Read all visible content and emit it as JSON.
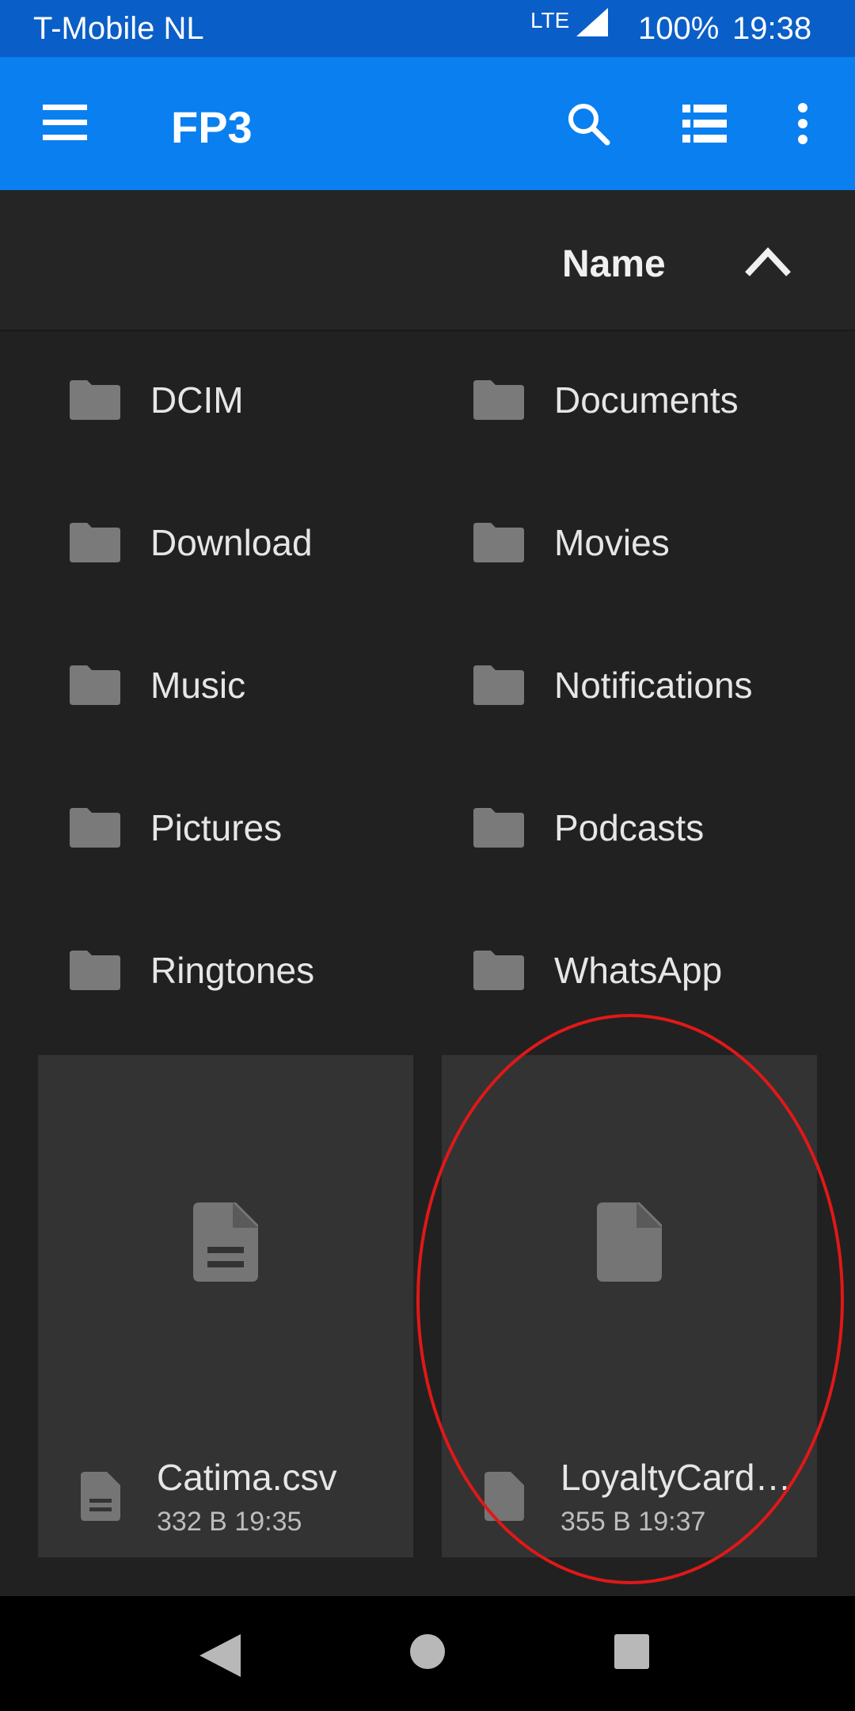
{
  "status_bar": {
    "carrier": "T-Mobile  NL",
    "network": "LTE",
    "battery": "100%",
    "time": "19:38"
  },
  "app_bar": {
    "title": "FP3",
    "icons": [
      "menu-icon",
      "search-icon",
      "list-view-icon",
      "more-vert-icon"
    ]
  },
  "sort": {
    "label": "Name",
    "direction_icon": "chevron-up-icon"
  },
  "folders": [
    {
      "name": "DCIM"
    },
    {
      "name": "Documents"
    },
    {
      "name": "Download"
    },
    {
      "name": "Movies"
    },
    {
      "name": "Music"
    },
    {
      "name": "Notifications"
    },
    {
      "name": "Pictures"
    },
    {
      "name": "Podcasts"
    },
    {
      "name": "Ringtones"
    },
    {
      "name": "WhatsApp"
    }
  ],
  "files": [
    {
      "name": "Catima.csv",
      "size": "332 B",
      "time": "19:35",
      "meta": "332 B 19:35",
      "icon": "text-document-icon"
    },
    {
      "name": "LoyaltyCard…",
      "size": "355 B",
      "time": "19:37",
      "meta": "355 B 19:37",
      "icon": "document-icon"
    }
  ],
  "colors": {
    "status_bar": "#0a5ec7",
    "app_bar": "#0a7ff0",
    "background": "#212121",
    "card": "#333333",
    "highlight": "#e01818"
  }
}
